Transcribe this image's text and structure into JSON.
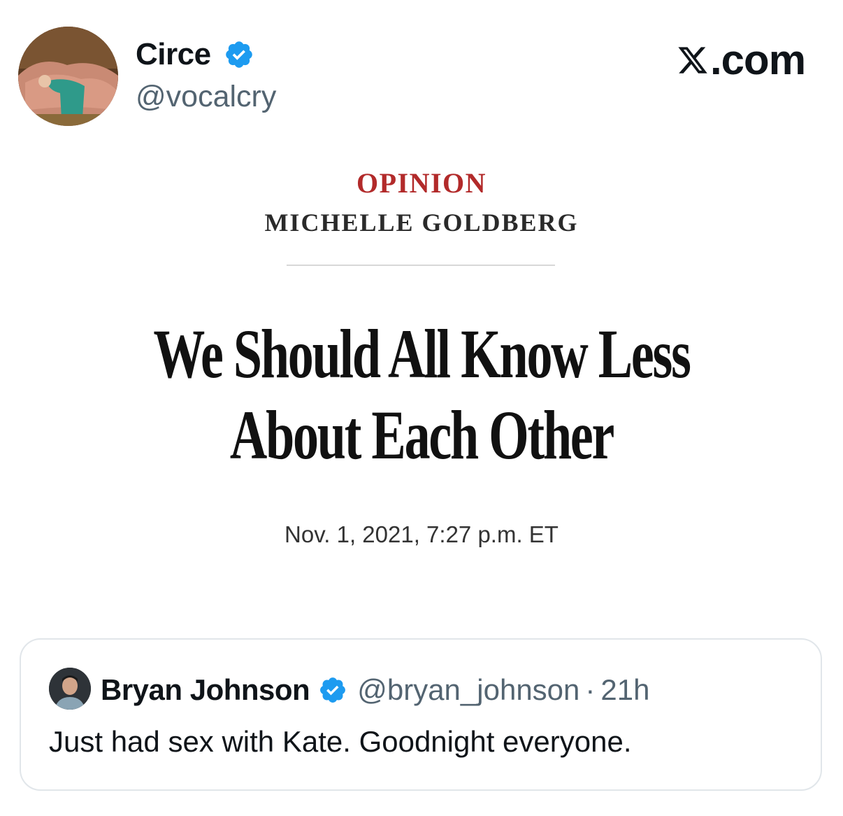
{
  "tweet": {
    "author": {
      "name": "Circe",
      "handle": "@vocalcry",
      "verified": true,
      "avatar": "reclining-figure-avatar"
    },
    "brand": {
      "logo": "x-logo-icon",
      "suffix": ".com"
    },
    "image": {
      "section": "OPINION",
      "byline": "MICHELLE GOLDBERG",
      "headline_line1": "We Should All Know Less",
      "headline_line2": "About Each Other",
      "date": "Nov. 1, 2021, 7:27 p.m. ET"
    },
    "quoted": {
      "name": "Bryan Johnson",
      "handle": "@bryan_johnson",
      "separator": "·",
      "time": "21h",
      "verified": true,
      "text": "Just had sex with Kate. Goodnight everyone."
    }
  },
  "colors": {
    "verified_blue": "#1d9bf0",
    "text": "#0f1419",
    "secondary": "#536471",
    "opinion_red": "#b22a2a",
    "card_border": "#e1e6ea"
  }
}
